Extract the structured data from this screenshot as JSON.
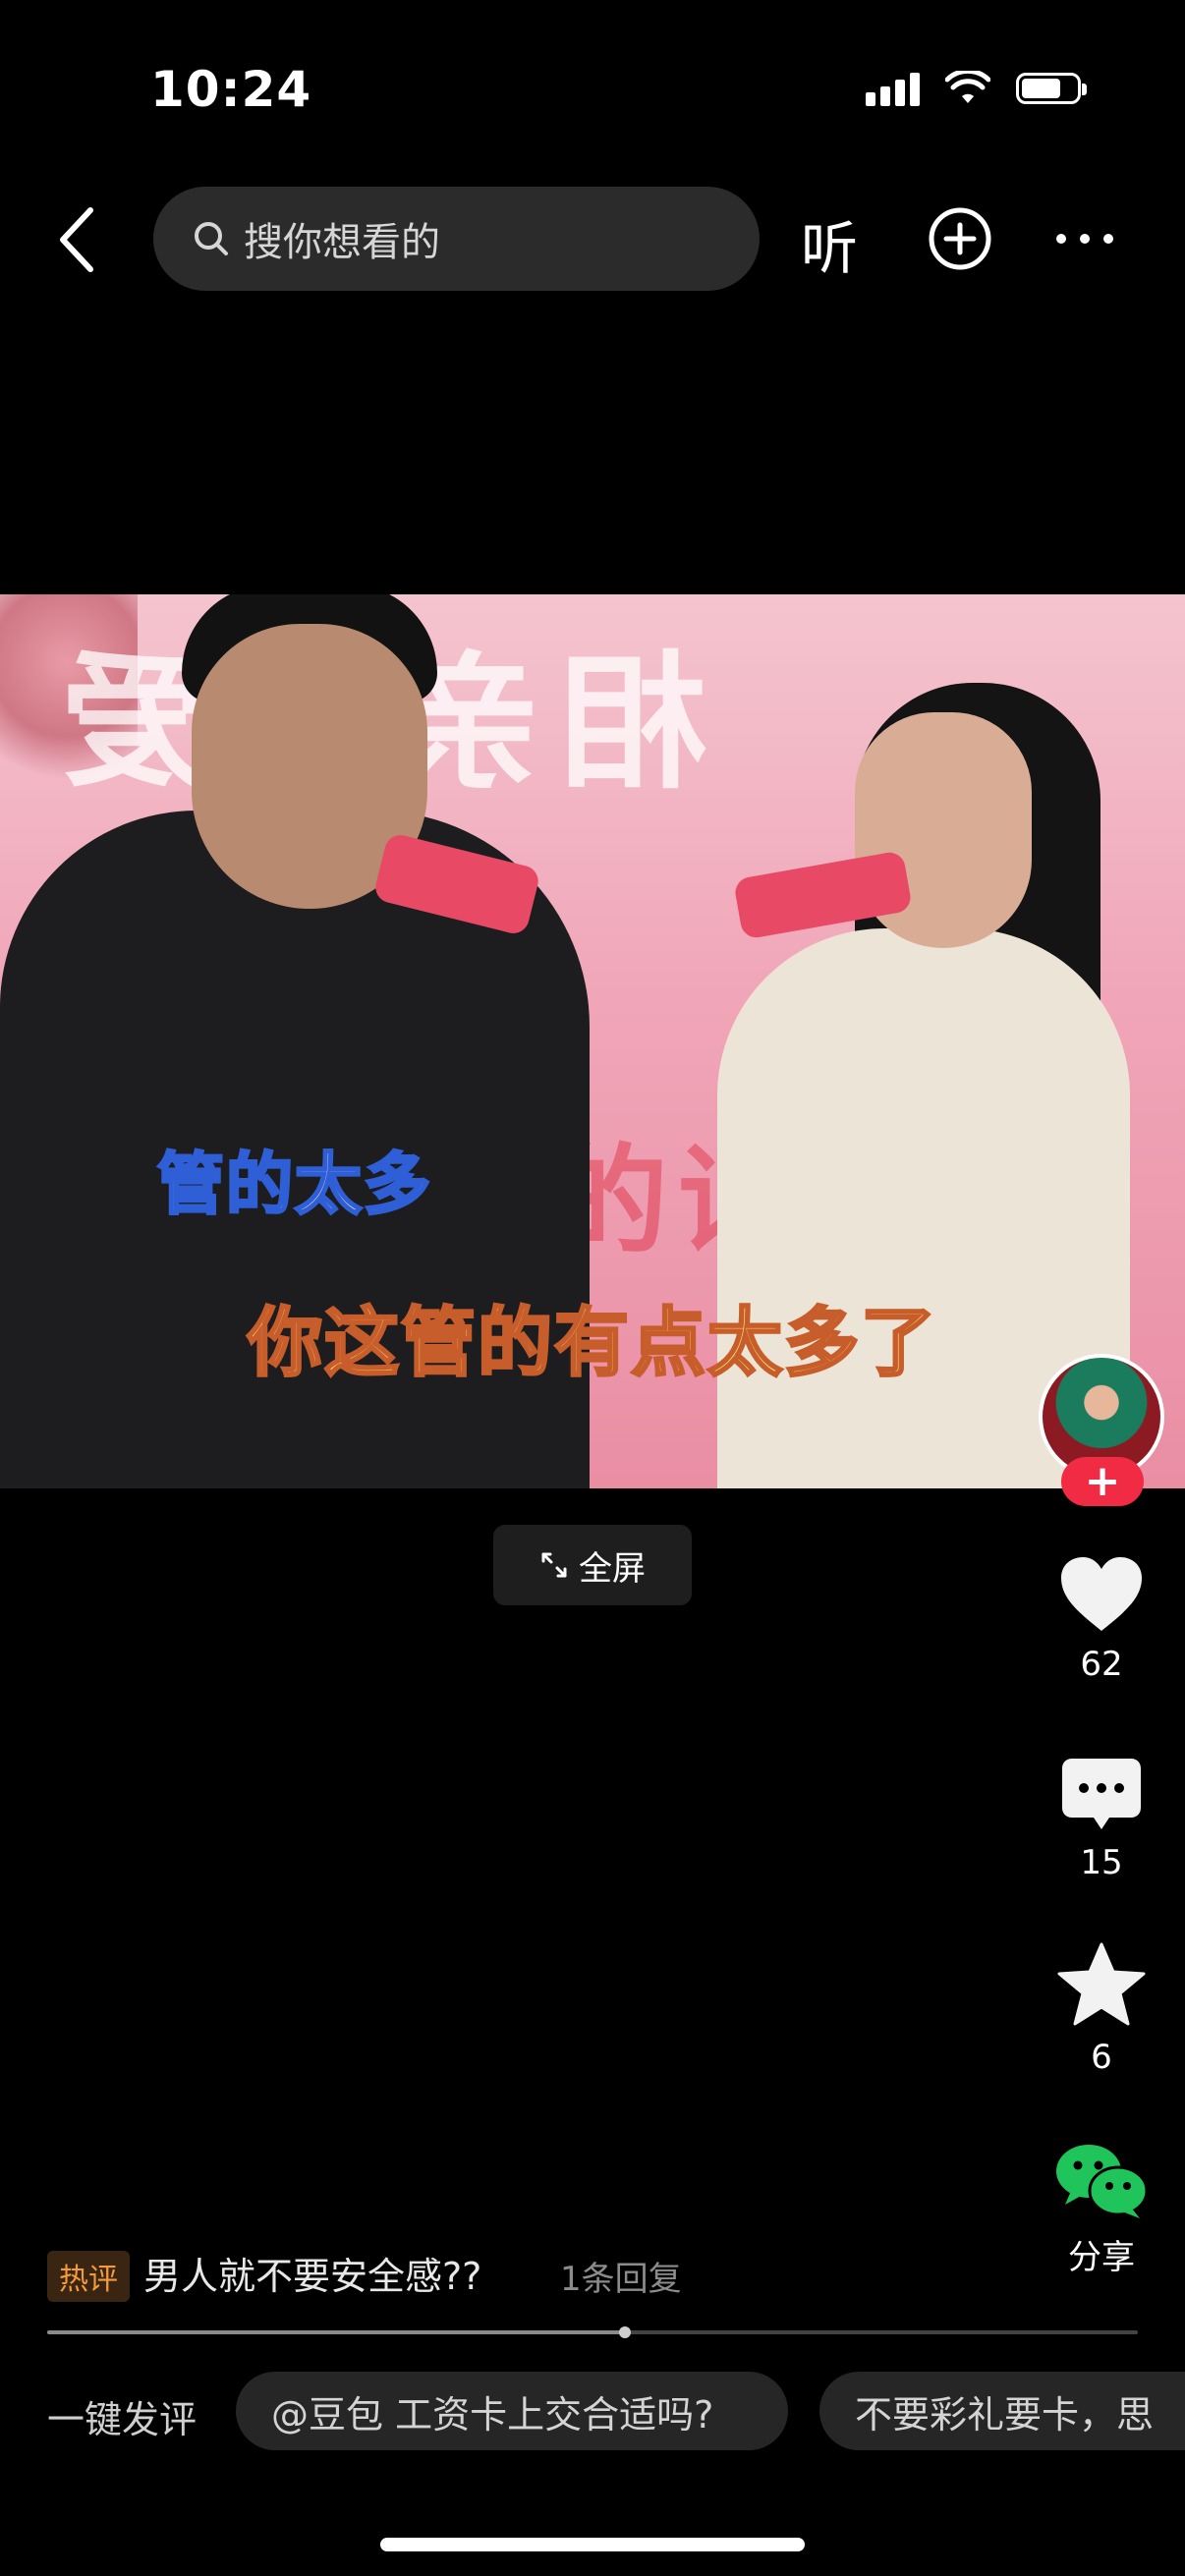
{
  "status_bar": {
    "time": "10:24",
    "signal_icon": "cellular-signal-icon",
    "wifi_icon": "wifi-icon",
    "battery_icon": "battery-icon"
  },
  "top_nav": {
    "back_icon": "chevron-left-icon",
    "search_placeholder": "搜你想看的",
    "search_icon": "search-icon",
    "listen_label": "听",
    "add_icon": "plus-circle-icon",
    "more_icon": "more-dots-icon"
  },
  "video": {
    "caption_small": "管的太多",
    "caption_main": "你这管的有点太多了",
    "bg_text": "相亲相爱",
    "bg_text2": "的话"
  },
  "fullscreen": {
    "label": "全屏",
    "icon": "expand-icon"
  },
  "actions": {
    "follow_label": "+",
    "like_count": "62",
    "comment_count": "15",
    "favorite_count": "6",
    "share_label": "分享",
    "like_icon": "heart-icon",
    "comment_icon": "comment-icon",
    "favorite_icon": "star-icon",
    "share_icon": "wechat-icon"
  },
  "hot_comment": {
    "tag": "热评",
    "text": "男人就不要安全感??",
    "reply_count": "1条回复"
  },
  "progress": {
    "fraction": 0.53
  },
  "quick_comment": {
    "label": "一键发评",
    "chips": [
      "@豆包 工资卡上交合适吗?",
      "不要彩礼要卡，思"
    ]
  },
  "colors": {
    "accent_red": "#f22b45",
    "hot_tag": "#f39a3a",
    "wechat_green": "#1fc45b"
  }
}
